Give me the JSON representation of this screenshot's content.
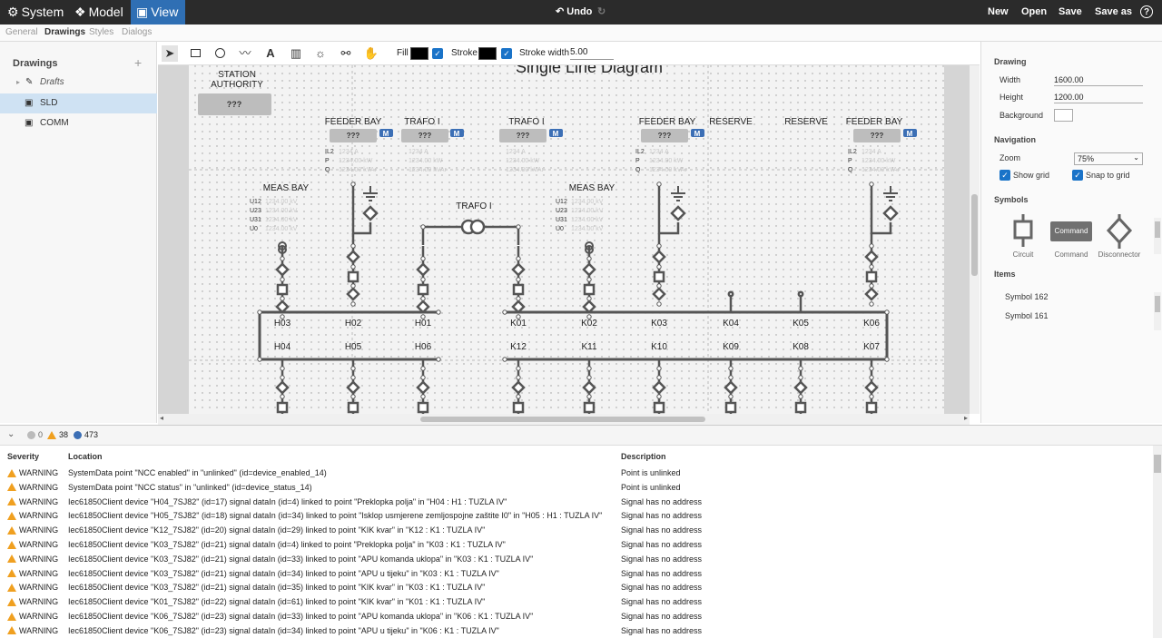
{
  "menu": {
    "system": "System",
    "model": "Model",
    "view": "View",
    "undo": "Undo",
    "new": "New",
    "open": "Open",
    "save": "Save",
    "save_as": "Save as",
    "help": "?"
  },
  "subtabs": [
    "General",
    "Drawings",
    "Styles",
    "Dialogs"
  ],
  "left_panel": {
    "title": "Drawings",
    "add": "+",
    "items": [
      "Drafts",
      "SLD",
      "COMM"
    ]
  },
  "toolbar": {
    "fill_label": "Fill",
    "stroke_label": "Stroke",
    "stroke_width_label": "Stroke width",
    "stroke_width_value": "5.00",
    "fill_color": "#000000",
    "stroke_color": "#000000"
  },
  "diagram": {
    "title": "Single Line Diagram",
    "station": "STATION\nAUTHORITY",
    "qqq": "???",
    "m": "M",
    "headers": {
      "feeder_bay": "FEEDER BAY",
      "trafo": "TRAFO I",
      "reserve": "RESERVE",
      "meas_bay": "MEAS BAY",
      "trafo_mid": "TRAFO I"
    },
    "meas_rows": [
      "IL2",
      "P",
      "Q"
    ],
    "meas_vals": [
      "1234 A",
      "1234.00 kW",
      "1234.00 kVAr"
    ],
    "volt_rows": [
      "U12",
      "U23",
      "U31",
      "U0"
    ],
    "volt_vals": [
      "1234.00 kV",
      "1234.00 kV",
      "1234.00 kV",
      "1234.00 kV"
    ],
    "top_bus_left": [
      "H03",
      "H02",
      "H01"
    ],
    "top_bus_right": [
      "K01",
      "K02",
      "K03",
      "K04",
      "K05",
      "K06"
    ],
    "bot_bus_left": [
      "H04",
      "H05",
      "H06"
    ],
    "bot_bus_right": [
      "K12",
      "K11",
      "K10",
      "K09",
      "K08",
      "K07"
    ]
  },
  "right_panel": {
    "drawing": "Drawing",
    "width_label": "Width",
    "width_value": "1600.00",
    "height_label": "Height",
    "height_value": "1200.00",
    "background_label": "Background",
    "navigation": "Navigation",
    "zoom_label": "Zoom",
    "zoom_value": "75%",
    "show_grid": "Show grid",
    "snap_grid": "Snap to grid",
    "symbols": "Symbols",
    "sym_circuit": "Circuit",
    "sym_command": "Command",
    "sym_command_inner": "Command",
    "sym_disconnector": "Disconnector",
    "items": "Items",
    "item_list": [
      "Symbol 162",
      "Symbol 161"
    ]
  },
  "log": {
    "count_errors": "0",
    "count_warnings": "38",
    "count_info": "473",
    "col_severity": "Severity",
    "col_location": "Location",
    "col_description": "Description",
    "rows": [
      {
        "sev": "WARNING",
        "loc": "SystemData point \"NCC enabled\" in \"unlinked\" (id=device_enabled_14)",
        "desc": "Point is unlinked"
      },
      {
        "sev": "WARNING",
        "loc": "SystemData point \"NCC status\" in \"unlinked\" (id=device_status_14)",
        "desc": "Point is unlinked"
      },
      {
        "sev": "WARNING",
        "loc": "Iec61850Client device \"H04_7SJ82\" (id=17) signal dataIn (id=4) linked to point \"Preklopka polja\" in \"H04 : H1 : TUZLA IV\"",
        "desc": "Signal has no address"
      },
      {
        "sev": "WARNING",
        "loc": "Iec61850Client device \"H05_7SJ82\" (id=18) signal dataIn (id=34) linked to point \"Isklop usmjerene zemljospojne zaštite I0\" in \"H05 : H1 : TUZLA IV\"",
        "desc": "Signal has no address"
      },
      {
        "sev": "WARNING",
        "loc": "Iec61850Client device \"K12_7SJ82\" (id=20) signal dataIn (id=29) linked to point \"KIK kvar\" in \"K12 : K1 : TUZLA IV\"",
        "desc": "Signal has no address"
      },
      {
        "sev": "WARNING",
        "loc": "Iec61850Client device \"K03_7SJ82\" (id=21) signal dataIn (id=4) linked to point \"Preklopka polja\" in \"K03 : K1 : TUZLA IV\"",
        "desc": "Signal has no address"
      },
      {
        "sev": "WARNING",
        "loc": "Iec61850Client device \"K03_7SJ82\" (id=21) signal dataIn (id=33) linked to point \"APU komanda uklopa\" in \"K03 : K1 : TUZLA IV\"",
        "desc": "Signal has no address"
      },
      {
        "sev": "WARNING",
        "loc": "Iec61850Client device \"K03_7SJ82\" (id=21) signal dataIn (id=34) linked to point \"APU u tijeku\" in \"K03 : K1 : TUZLA IV\"",
        "desc": "Signal has no address"
      },
      {
        "sev": "WARNING",
        "loc": "Iec61850Client device \"K03_7SJ82\" (id=21) signal dataIn (id=35) linked to point \"KIK kvar\" in \"K03 : K1 : TUZLA IV\"",
        "desc": "Signal has no address"
      },
      {
        "sev": "WARNING",
        "loc": "Iec61850Client device \"K01_7SJ82\" (id=22) signal dataIn (id=61) linked to point \"KIK kvar\" in \"K01 : K1 : TUZLA IV\"",
        "desc": "Signal has no address"
      },
      {
        "sev": "WARNING",
        "loc": "Iec61850Client device \"K06_7SJ82\" (id=23) signal dataIn (id=33) linked to point \"APU komanda uklopa\" in \"K06 : K1 : TUZLA IV\"",
        "desc": "Signal has no address"
      },
      {
        "sev": "WARNING",
        "loc": "Iec61850Client device \"K06_7SJ82\" (id=23) signal dataIn (id=34) linked to point \"APU u tijeku\" in \"K06 : K1 : TUZLA IV\"",
        "desc": "Signal has no address"
      }
    ]
  }
}
